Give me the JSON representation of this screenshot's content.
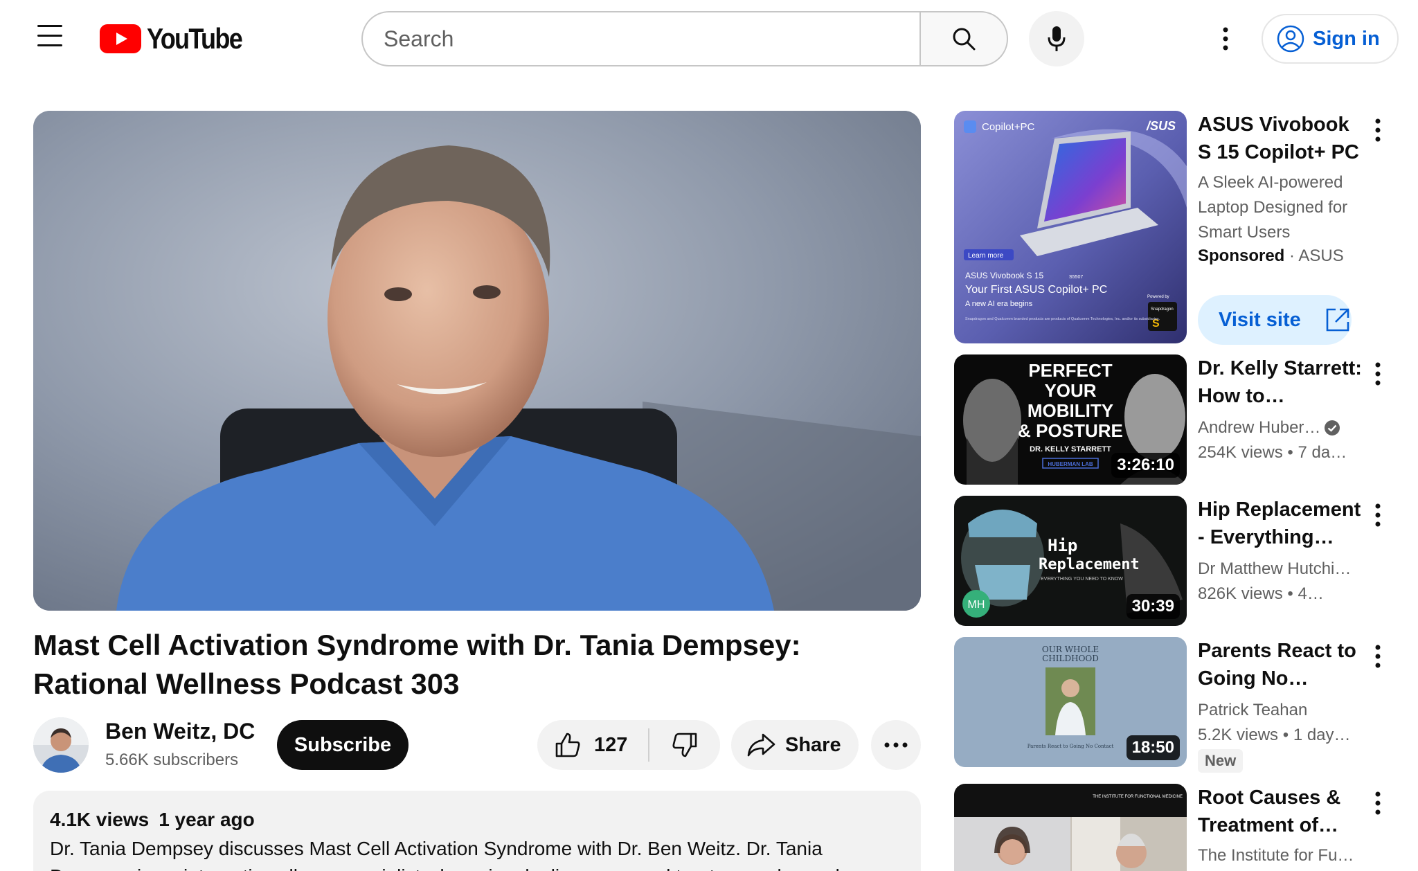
{
  "header": {
    "logo_text": "YouTube",
    "search_placeholder": "Search",
    "sign_in_label": "Sign in"
  },
  "video": {
    "title": "Mast Cell Activation Syndrome with Dr. Tania Dempsey: Rational Wellness Podcast 303",
    "channel_name": "Ben Weitz, DC",
    "subscribers": "5.66K subscribers",
    "subscribe_label": "Subscribe",
    "like_count": "127",
    "share_label": "Share",
    "views": "4.1K views",
    "age": "1 year ago",
    "description": "Dr. Tania Dempsey discusses Mast Cell Activation Syndrome with Dr. Ben Weitz.  Dr. Tania Dempsey is an integrative allergy specialist who uniquely diagnoses and treats complex and"
  },
  "ad": {
    "title": "ASUS Vivobook S 15 Copilot+ PC",
    "description": "A Sleek AI-powered Laptop Designed for Smart Users",
    "sponsored_label": "Sponsored",
    "advertiser": "ASUS",
    "visit_label": "Visit site",
    "thumb": {
      "brand_left": "Copilot+PC",
      "brand_right": "/SUS",
      "learn_more": "Learn more",
      "model": "ASUS Vivobook S 15",
      "model_code": "S5507",
      "headline": "Your First ASUS Copilot+ PC",
      "tagline": "A new AI era begins",
      "powered_by": "Powered by",
      "chip": "Snapdragon",
      "fineprint": "Snapdragon and Qualcomm branded products are products of Qualcomm Technologies, Inc. and/or its subsidiaries."
    }
  },
  "recommendations": [
    {
      "title": "Dr. Kelly Starrett: How to Improve…",
      "channel": "Andrew Huber…",
      "verified": true,
      "views": "254K views",
      "age": "7 da…",
      "duration": "3:26:10",
      "thumb_text": [
        "PERFECT",
        "YOUR",
        "MOBILITY",
        "& POSTURE"
      ],
      "thumb_sub": "DR. KELLY STARRETT",
      "thumb_badge": "HUBERMAN LAB"
    },
    {
      "title": "Hip Replacement - Everything you…",
      "channel": "Dr Matthew Hutchi…",
      "views": "826K views",
      "age": "4…",
      "duration": "30:39",
      "thumb_text": [
        "Hip",
        "Replacement"
      ],
      "thumb_sub": "EVERYTHING YOU NEED TO KNOW",
      "thumb_badge": "MH"
    },
    {
      "title": "Parents React to Going No Contact",
      "channel": "Patrick Teahan",
      "views": "5.2K views",
      "age": "1 day…",
      "badge": "New",
      "duration": "18:50",
      "thumb_text": [
        "OUR WHOLE",
        "CHILDHOOD"
      ],
      "thumb_sub": "Parents React to Going No Contact"
    },
    {
      "title": "Root Causes & Treatment of…",
      "channel": "The Institute for Fu…",
      "thumb_badge": "THE INSTITUTE FOR FUNCTIONAL MEDICINE"
    }
  ],
  "colors": {
    "youtube_red": "#ff0000",
    "link_blue": "#065fd4",
    "chip_bg": "#f2f2f2",
    "text_secondary": "#606060"
  }
}
